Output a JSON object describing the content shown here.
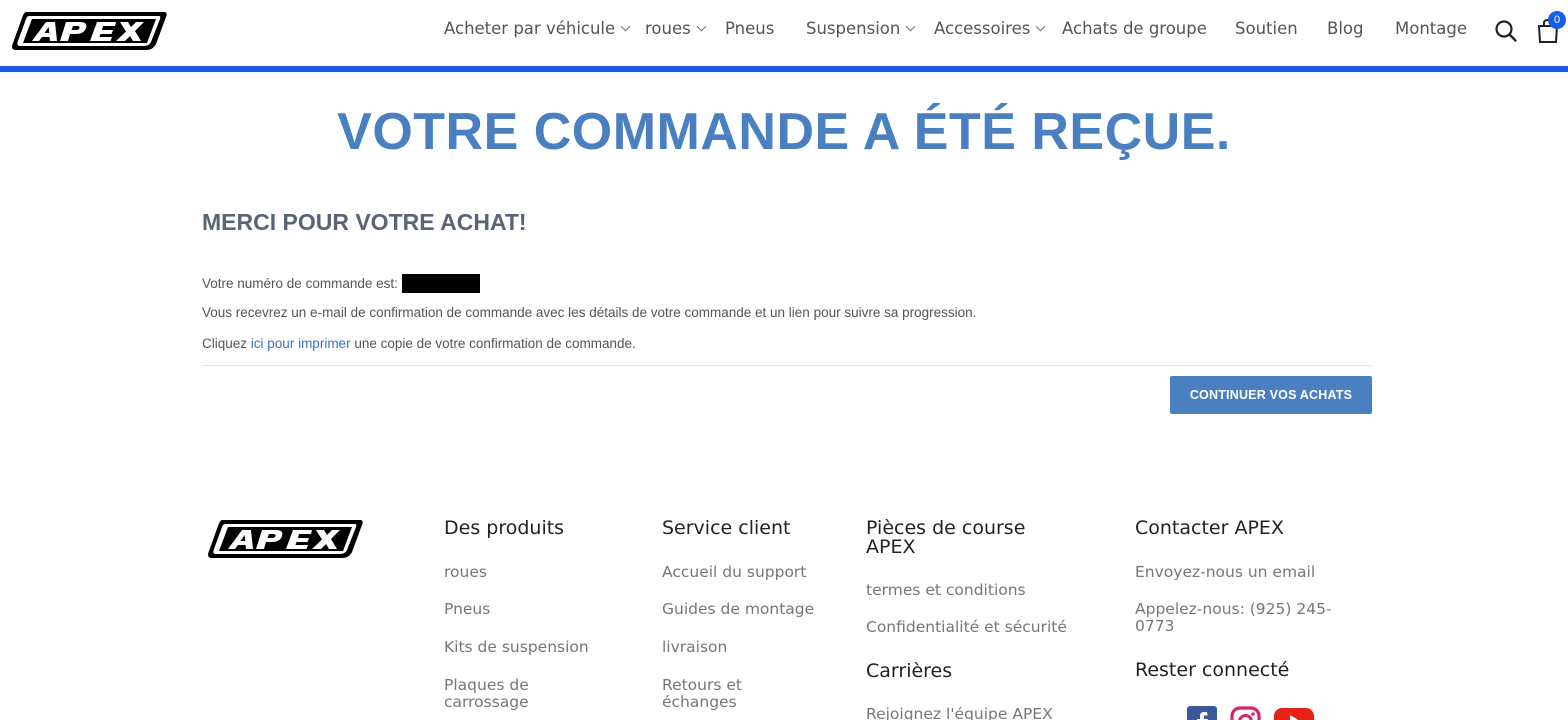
{
  "header": {
    "nav": [
      {
        "label": "Acheter par véhicule",
        "dropdown": true
      },
      {
        "label": "roues",
        "dropdown": true
      },
      {
        "label": "Pneus",
        "dropdown": false
      },
      {
        "label": "Suspension",
        "dropdown": true
      },
      {
        "label": "Accessoires",
        "dropdown": true
      },
      {
        "label": "Achats de groupe",
        "dropdown": false
      },
      {
        "label": "Soutien",
        "dropdown": false
      },
      {
        "label": "Blog",
        "dropdown": false
      },
      {
        "label": "Montage",
        "dropdown": false
      }
    ],
    "cart_count": "0",
    "logo_text": "APEX",
    "accent_color": "#1a5ce8"
  },
  "main": {
    "title": "VOTRE COMMANDE A ÉTÉ REÇUE.",
    "thanks": "MERCI POUR VOTRE ACHAT!",
    "order_label": "Votre numéro de commande est:",
    "email_notice": "Vous recevrez un e-mail de confirmation de commande avec les détails de votre commande et un lien pour suivre sa progression.",
    "print_prefix": "Cliquez",
    "print_link": "ici pour imprimer",
    "print_suffix": "une copie de votre confirmation de commande.",
    "continue_label": "CONTINUER VOS ACHATS",
    "title_color": "#4a7fc1"
  },
  "footer": {
    "products": {
      "heading": "Des produits",
      "links": [
        "roues",
        "Pneus",
        "Kits de suspension",
        "Plaques de carrossage"
      ]
    },
    "service": {
      "heading": "Service client",
      "links": [
        "Accueil du support",
        "Guides de montage",
        "livraison",
        "Retours et échanges"
      ]
    },
    "racing": {
      "heading": "Pièces de course APEX",
      "links": [
        "termes et conditions",
        "Confidentialité et sécurité"
      ],
      "careers_heading": "Carrières",
      "careers_link": "Rejoignez l'équipe APEX"
    },
    "contact": {
      "heading": "Contacter APEX",
      "email_link": "Envoyez-nous un email",
      "phone_link": "Appelez-nous: (925) 245-0773",
      "social_heading": "Rester connecté"
    },
    "social_icons": [
      "facebook-icon",
      "instagram-icon",
      "youtube-icon"
    ]
  }
}
